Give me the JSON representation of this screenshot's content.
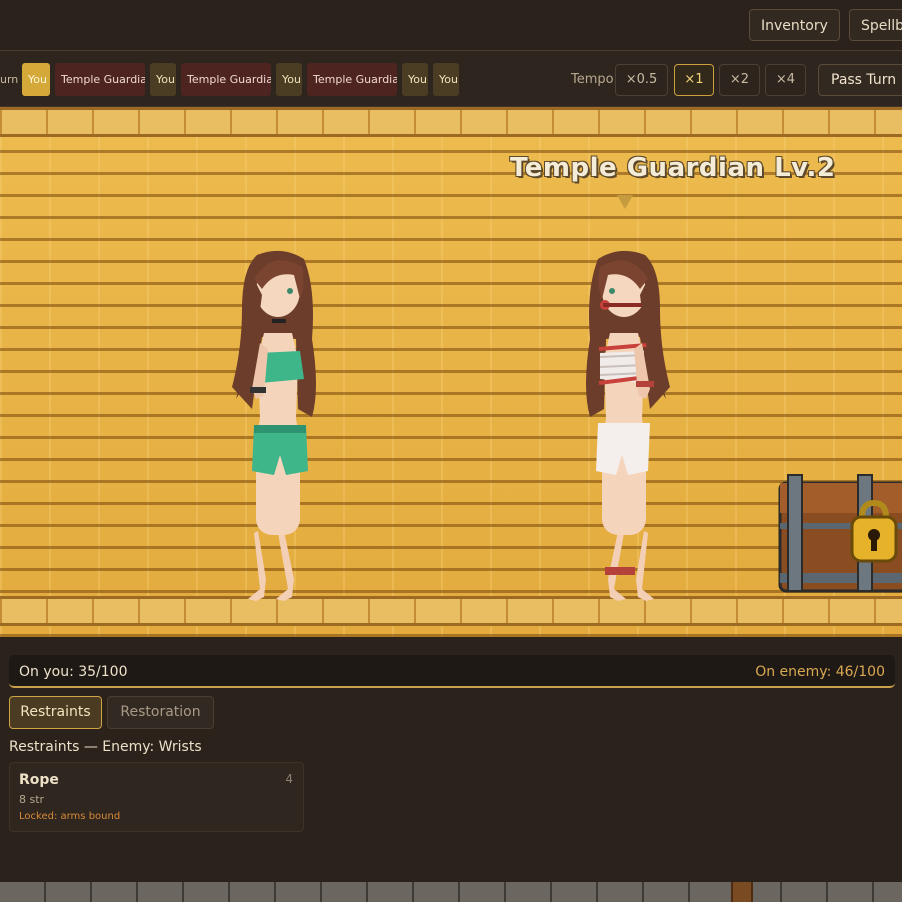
{
  "topbar": {
    "inventory_label": "Inventory",
    "spellbook_label": "Spellb"
  },
  "turn_order": {
    "partial_label": "urn",
    "chips": [
      {
        "label": "You",
        "kind": "you",
        "current": true
      },
      {
        "label": "Temple Guardian",
        "kind": "enemy"
      },
      {
        "label": "You",
        "kind": "you"
      },
      {
        "label": "Temple Guardian",
        "kind": "enemy"
      },
      {
        "label": "You",
        "kind": "you"
      },
      {
        "label": "Temple Guardian",
        "kind": "enemy"
      },
      {
        "label": "You",
        "kind": "you"
      },
      {
        "label": "You",
        "kind": "you"
      }
    ]
  },
  "tempo": {
    "label": "Tempo",
    "options": [
      "×0.5",
      "×1",
      "×2",
      "×4"
    ],
    "selected": "×1"
  },
  "pass_turn_label": "Pass Turn",
  "scene": {
    "enemy_name": "Temple Guardian Lv.2",
    "colors": {
      "wall": "#e9b548",
      "mortar": "#9c6a22"
    }
  },
  "status": {
    "on_you": "On you: 35/100",
    "on_enemy": "On enemy: 46/100"
  },
  "tabs": {
    "restraints": "Restraints",
    "restoration": "Restoration",
    "active": "Restraints"
  },
  "section_title": "Restraints — Enemy: Wrists",
  "items": [
    {
      "name": "Rope",
      "count": "4",
      "str": "8 str",
      "note": "Locked: arms bound"
    }
  ],
  "colors": {
    "accent": "#d0a544",
    "enemy_chip": "#4d2420",
    "warning": "#d98a3a"
  }
}
